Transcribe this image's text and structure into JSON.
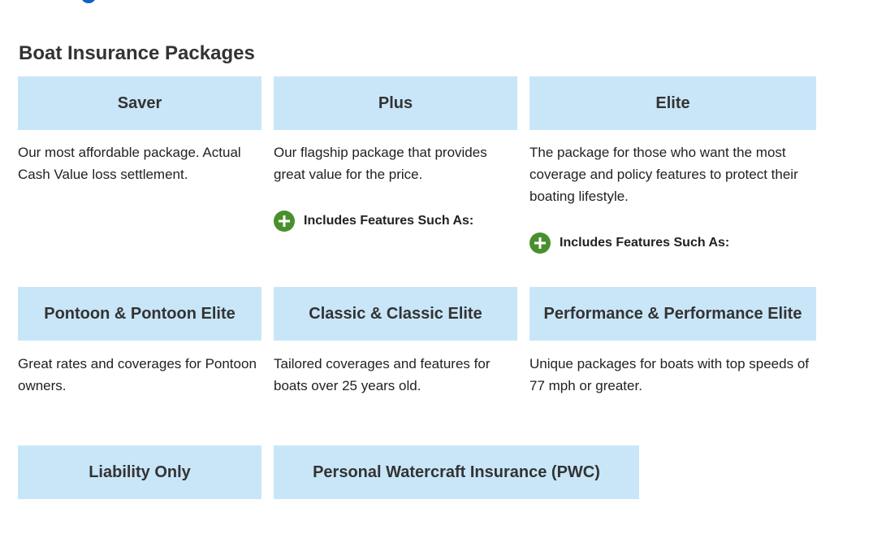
{
  "section": {
    "title": "Boat Insurance Packages"
  },
  "packages": [
    {
      "name": "Saver",
      "description": "Our most affordable package. Actual Cash Value loss settlement."
    },
    {
      "name": "Plus",
      "description": "Our flagship package that provides great value for the price.",
      "features_label": "Includes Features Such As:"
    },
    {
      "name": "Elite",
      "description": "The package for those who want the most coverage and policy features to protect their boating lifestyle.",
      "features_label": "Includes Features Such As:"
    },
    {
      "name": "Pontoon & Pontoon Elite",
      "description": "Great rates and coverages for Pontoon owners."
    },
    {
      "name": "Classic & Classic Elite",
      "description": "Tailored coverages and features for boats over 25 years old."
    },
    {
      "name": "Performance & Performance Elite",
      "description": "Unique packages for boats with top speeds of 77 mph or greater."
    },
    {
      "name": "Liability Only"
    },
    {
      "name": "Personal Watercraft Insurance (PWC)"
    }
  ],
  "colors": {
    "header_bg": "#c8e6f8",
    "plus_icon": "#4a8f2e",
    "text": "#333333"
  },
  "icons": {
    "features_toggle": "plus-circle-icon"
  }
}
